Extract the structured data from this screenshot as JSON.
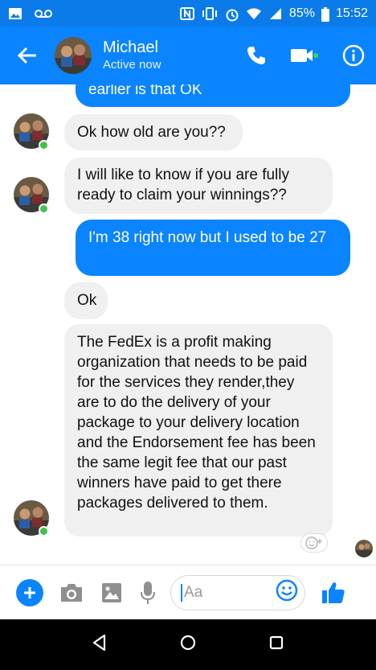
{
  "status_bar": {
    "battery": "85%",
    "time": "15:52"
  },
  "header": {
    "contact_name": "Michael",
    "contact_status": "Active now"
  },
  "messages": [
    {
      "side": "out",
      "text": "earlier is that OK"
    },
    {
      "side": "in",
      "text": "Ok how old are you??"
    },
    {
      "side": "in",
      "text": "I will like to know if you are fully ready to claim your winnings??"
    },
    {
      "side": "out",
      "text": "I'm 38 right now but I used to be 27"
    },
    {
      "side": "in",
      "text": "Ok"
    },
    {
      "side": "in",
      "text": "The FedEx is a profit making organization that needs to be paid for the services they render,they are to do the delivery of your package to your delivery location and the  Endorsement fee has been the same legit fee that our past winners have paid to get there packages delivered to them."
    }
  ],
  "composer": {
    "placeholder": "Aa"
  },
  "colors": {
    "brand": "#0a84ff",
    "status_bar": "#0a7be8",
    "incoming_bubble": "#f0f0f0",
    "online": "#44c14b"
  },
  "icons": [
    "image-icon",
    "voicemail-icon",
    "nfc-icon",
    "vibrate-icon",
    "alarm-icon",
    "wifi-icon",
    "signal-icon",
    "battery-icon",
    "back-arrow-icon",
    "phone-icon",
    "video-icon",
    "info-icon",
    "add-icon",
    "camera-icon",
    "gallery-icon",
    "mic-icon",
    "emoji-icon",
    "thumbs-up-icon",
    "nav-back-icon",
    "nav-home-icon",
    "nav-recents-icon"
  ]
}
